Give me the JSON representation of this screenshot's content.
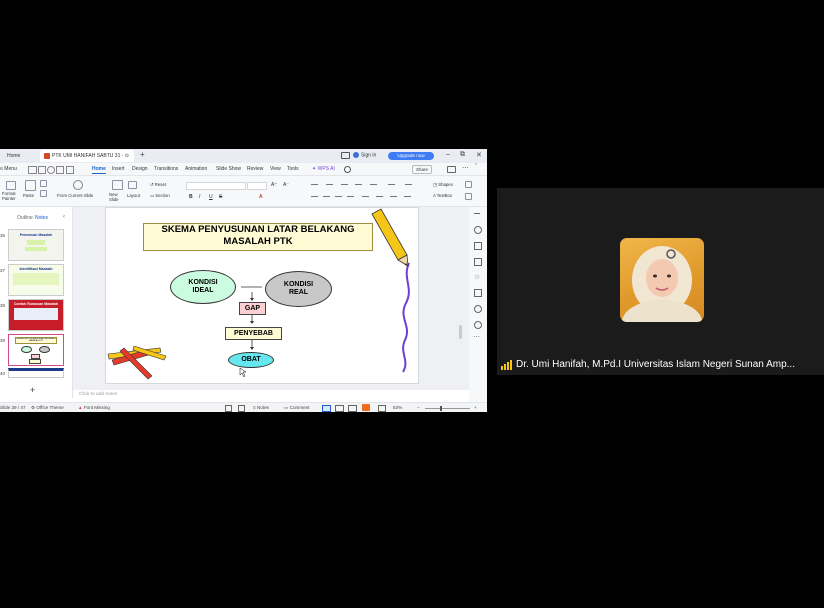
{
  "window": {
    "tabs": [
      {
        "label": "Home"
      },
      {
        "label": "PTK UMI HANIFAH SABTU 31 · ⊙"
      }
    ],
    "sign_in": "Sign in",
    "upgrade": "Upgrade now",
    "win_minimize": "–",
    "win_restore": "⧉",
    "win_close": "✕"
  },
  "menu": {
    "menu_label": "≡ Menu",
    "items": [
      "Home",
      "Insert",
      "Design",
      "Transitions",
      "Animation",
      "Slide Show",
      "Review",
      "View",
      "Tools"
    ],
    "wps_ai": "WPS AI",
    "share": "Share"
  },
  "ribbon": {
    "format_painter": "Format Painter",
    "paste": "Paste",
    "from_current_slide": "From Current Slide",
    "new_slide": "New Slide",
    "reset": "Reset",
    "layout": "Layout",
    "section": "Section",
    "shapes": "Shapes",
    "textbox": "TextBox"
  },
  "left_pane": {
    "outline": "Outline",
    "notes": "Notes",
    "thumbnails": [
      {
        "num": "36",
        "caption": "Penemuan Masalah"
      },
      {
        "num": "37",
        "caption": "Identifikasi Masalah"
      },
      {
        "num": "38",
        "caption": "Contoh Rumusan Masalah"
      },
      {
        "num": "39",
        "caption": "SKEMA PENYUSUNAN LATAR BELAKANG MASALAH PTK"
      },
      {
        "num": "40",
        "caption": ""
      }
    ],
    "add": "+"
  },
  "slide": {
    "title_line1": "SKEMA PENYUSUNAN LATAR BELAKANG",
    "title_line2": "MASALAH PTK",
    "kondisi_ideal_1": "KONDISI",
    "kondisi_ideal_2": "IDEAL",
    "kondisi_real_1": "KONDISI",
    "kondisi_real_2": "REAL",
    "gap": "GAP",
    "penyebab": "PENYEBAB",
    "obat": "OBAT"
  },
  "notes_placeholder": "Click to add notes",
  "status": {
    "slide_count": "Slide 39 / 47",
    "theme": "Office Theme",
    "font_missing": "Font Missing",
    "notes": "Notes",
    "comment": "Comment",
    "zoom": "63%",
    "zoom_minus": "–",
    "zoom_plus": "+"
  },
  "participant": {
    "name": "Dr. Umi Hanifah, M.Pd.I Universitas Islam Negeri Sunan Amp..."
  },
  "colors": {
    "accent": "#3f7cf4",
    "ellipse_green": "#ccfce0",
    "ellipse_gray": "#c8c8c8",
    "gap_pink": "#fbd0d4",
    "obat_cyan": "#66e8f0",
    "title_box": "#fffbd4"
  }
}
